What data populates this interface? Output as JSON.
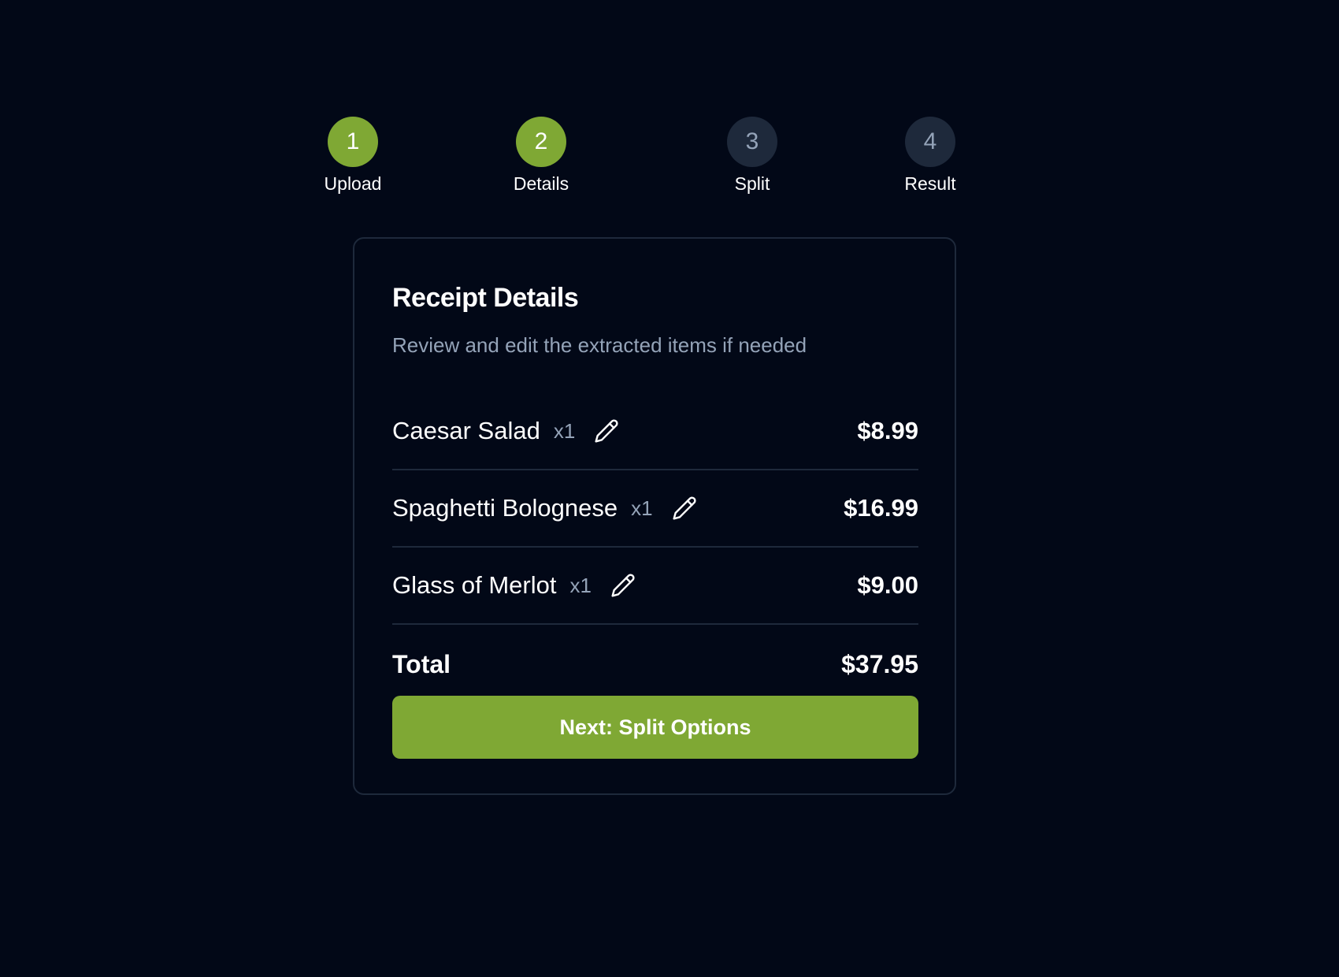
{
  "stepper": {
    "steps": [
      {
        "number": "1",
        "label": "Upload",
        "state": "complete"
      },
      {
        "number": "2",
        "label": "Details",
        "state": "active"
      },
      {
        "number": "3",
        "label": "Split",
        "state": "inactive"
      },
      {
        "number": "4",
        "label": "Result",
        "state": "inactive"
      }
    ]
  },
  "card": {
    "title": "Receipt Details",
    "subtitle": "Review and edit the extracted items if needed",
    "items": [
      {
        "name": "Caesar Salad",
        "qty": "x1",
        "price": "$8.99",
        "edit_icon": "pencil-icon"
      },
      {
        "name": "Spaghetti Bolognese",
        "qty": "x1",
        "price": "$16.99",
        "edit_icon": "pencil-icon"
      },
      {
        "name": "Glass of Merlot",
        "qty": "x1",
        "price": "$9.00",
        "edit_icon": "pencil-icon"
      }
    ],
    "total_label": "Total",
    "total_value": "$37.95",
    "next_button_label": "Next: Split Options"
  },
  "colors": {
    "background": "#020817",
    "accent": "#7fa834",
    "inactive_step": "#1e293b",
    "muted_text": "#94a3b8",
    "border": "#1e293b"
  }
}
